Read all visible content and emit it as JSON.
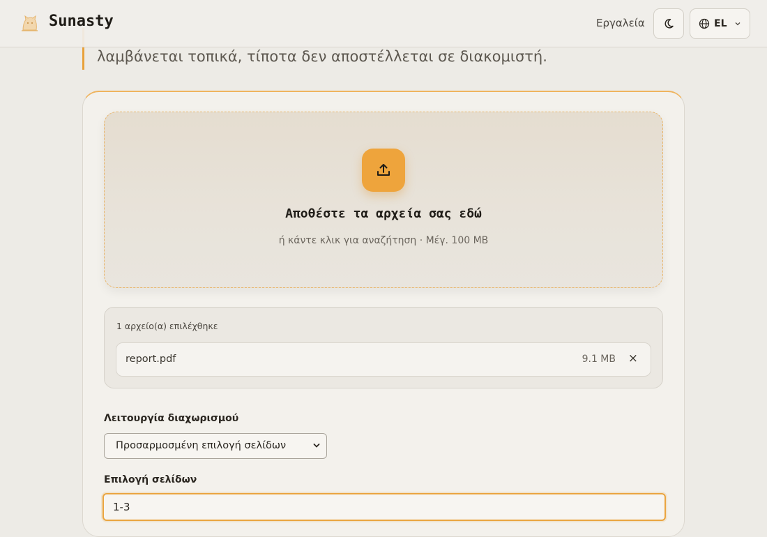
{
  "header": {
    "brand": "Sunasty",
    "nav_tools": "Εργαλεία",
    "lang": "EL"
  },
  "intro": {
    "text": "λαμβάνεται τοπικά, τίποτα δεν αποστέλλεται σε διακομιστή."
  },
  "dropzone": {
    "title": "Αποθέστε τα αρχεία σας εδώ",
    "subtitle": "ή κάντε κλικ για αναζήτηση · Μέγ. 100 MB"
  },
  "files": {
    "count_label": "1 αρχείο(α) επιλέχθηκε",
    "items": [
      {
        "name": "report.pdf",
        "size": "9.1 MB",
        "remove": "×"
      }
    ]
  },
  "split_mode": {
    "label": "Λειτουργία διαχωρισμού",
    "selected": "Προσαρμοσμένη επιλογή σελίδων"
  },
  "page_selection": {
    "label": "Επιλογή σελίδων",
    "value": "1-3"
  },
  "colors": {
    "accent": "#eea43c",
    "background": "#edebe6"
  }
}
